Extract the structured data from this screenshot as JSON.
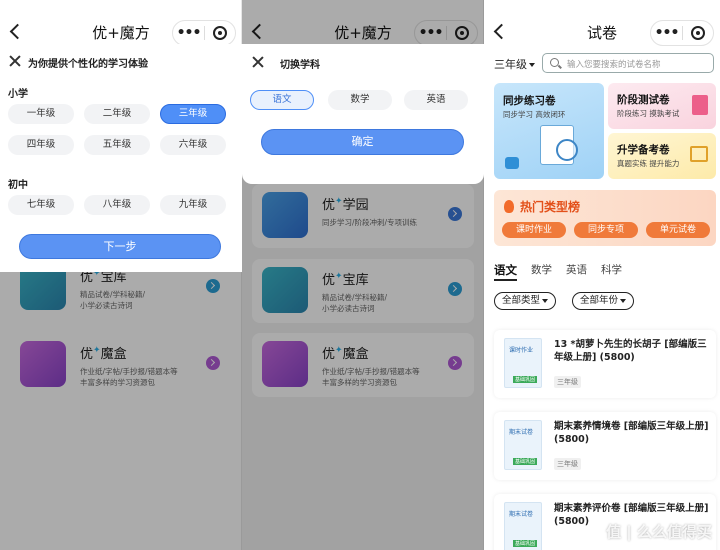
{
  "capsule": {
    "more": "•••"
  },
  "panel1": {
    "nav_title": "优+魔方",
    "sheet_title": "为你提供个性化的学习体验",
    "primary_label": "小学",
    "primary_grades": [
      "一年级",
      "二年级",
      "三年级",
      "四年级",
      "五年级",
      "六年级"
    ],
    "selected_grade": "三年级",
    "middle_label": "初中",
    "middle_grades": [
      "七年级",
      "八年级",
      "九年级"
    ],
    "next_button": "下一步"
  },
  "panel2": {
    "nav_title": "优+魔方",
    "sheet_title": "切换学科",
    "subjects": [
      "语文",
      "数学",
      "英语"
    ],
    "selected_subject": "语文",
    "confirm_button": "确定"
  },
  "cards": {
    "xueyuan": {
      "title": "优",
      "title_suffix": "学园",
      "desc": "同步学习/阶段冲刺/专项训练"
    },
    "baoku": {
      "title": "优",
      "title_suffix": "宝库",
      "desc1": "精品试卷/学科秘籍/",
      "desc2": "小学必读古诗词"
    },
    "mohe": {
      "title": "优",
      "title_suffix": "魔盒",
      "desc1": "作业纸/字帖/手抄报/错题本等",
      "desc2": "丰富多样的学习资源包"
    }
  },
  "panel3": {
    "nav_title": "试卷",
    "grade": "三年级",
    "search_placeholder": "输入您要搜索的试卷名称",
    "features": [
      {
        "title": "同步练习卷",
        "sub": "同步学习 高效闭环"
      },
      {
        "title": "阶段测试卷",
        "sub": "阶段练习 摸孰考试"
      },
      {
        "title": "升学备考卷",
        "sub": "真题实练 提升能力"
      }
    ],
    "hot_title": "热门类型榜",
    "hot_buttons": [
      "课时作业",
      "同步专项",
      "单元试卷"
    ],
    "tabs": [
      "语文",
      "数学",
      "英语",
      "科学"
    ],
    "active_tab": "语文",
    "filters": [
      "全部类型",
      "全部年份"
    ],
    "papers": [
      {
        "thumb_label": "课时作业",
        "thumb_tag": "基础巩固",
        "title": "13 *胡萝卜先生的长胡子 [部编版三年级上册] (5800)",
        "grade": "三年级"
      },
      {
        "thumb_label": "期末试卷",
        "thumb_tag": "基础巩固",
        "title": "期末素养情境卷 [部编版三年级上册] (5800)",
        "grade": "三年级"
      },
      {
        "thumb_label": "期末试卷",
        "thumb_tag": "基础巩固",
        "title": "期末素养评价卷 [部编版三年级上册] (5800)",
        "grade": "三年级"
      }
    ],
    "watermark": "值 | 么么值得买"
  },
  "colors": {
    "primary": "#5b93f3",
    "hot": "#f07a3a"
  }
}
